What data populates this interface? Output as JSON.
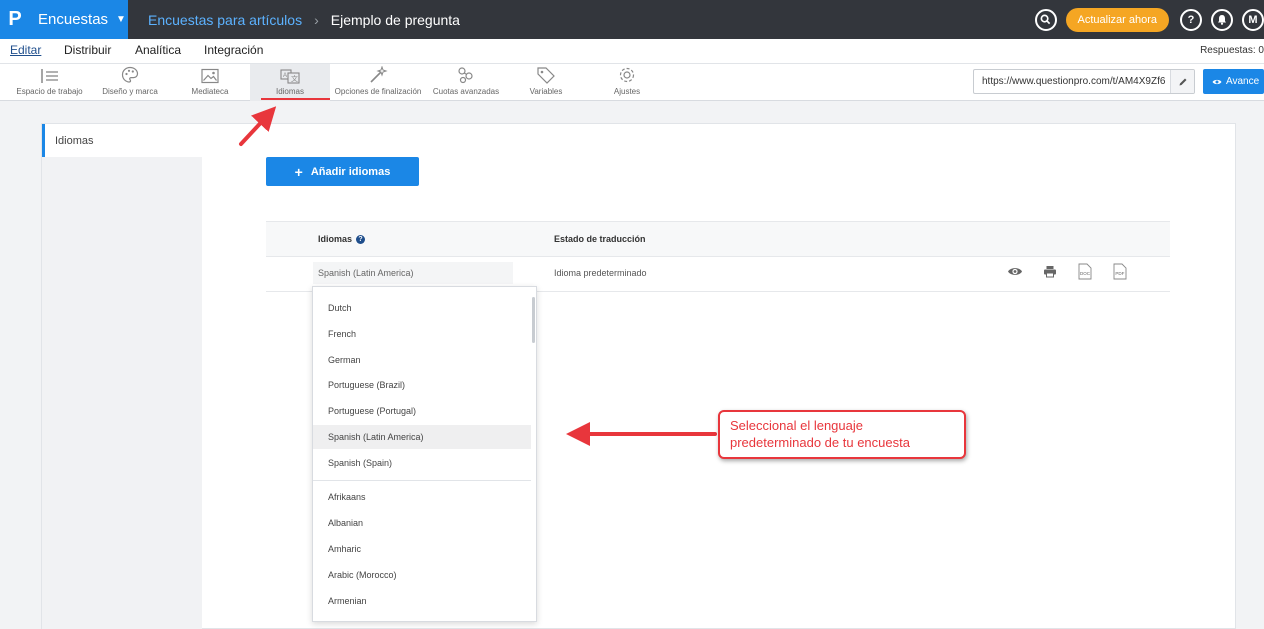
{
  "topbar": {
    "logo": "P",
    "product": "Encuestas",
    "breadcrumb_parent": "Encuestas para artículos",
    "breadcrumb_sep": "›",
    "breadcrumb_current": "Ejemplo de pregunta",
    "search_icon": "search-icon",
    "upgrade_label": "Actualizar ahora",
    "help_label": "?",
    "avatar_initial": "M"
  },
  "nav": {
    "items": [
      "Editar",
      "Distribuir",
      "Analítica",
      "Integración"
    ],
    "active": "Editar",
    "responses_label": "Respuestas: 0"
  },
  "toolbar": {
    "items": [
      {
        "label": "Espacio de trabajo",
        "icon": "workspace-icon"
      },
      {
        "label": "Diseño y marca",
        "icon": "palette-icon"
      },
      {
        "label": "Mediateca",
        "icon": "image-icon"
      },
      {
        "label": "Idiomas",
        "icon": "translate-icon",
        "active": true
      },
      {
        "label": "Opciones de finalización",
        "icon": "magic-wand-icon"
      },
      {
        "label": "Cuotas avanzadas",
        "icon": "quota-icon"
      },
      {
        "label": "Variables",
        "icon": "tag-icon"
      },
      {
        "label": "Ajustes",
        "icon": "gear-icon"
      }
    ],
    "url": "https://www.questionpro.com/t/AM4X9Zf6",
    "advance_label": "Avance"
  },
  "sidebar": {
    "active_item": "Idiomas"
  },
  "main": {
    "add_button_label": "Añadir idiomas",
    "table": {
      "col_languages": "Idiomas",
      "col_state": "Estado de traducción",
      "row": {
        "language": "Spanish (Latin America)",
        "state": "Idioma predeterminado"
      }
    }
  },
  "dropdown": {
    "group1": [
      "Dutch",
      "French",
      "German",
      "Portuguese (Brazil)",
      "Portuguese (Portugal)",
      "Spanish (Latin America)",
      "Spanish (Spain)"
    ],
    "highlighted": "Spanish (Latin America)",
    "group2": [
      "Afrikaans",
      "Albanian",
      "Amharic",
      "Arabic (Morocco)",
      "Armenian"
    ]
  },
  "annotation": {
    "line1": "Seleccional el lenguaje",
    "line2": "predeterminado de tu encuesta",
    "color": "#e8363c"
  },
  "colors": {
    "primary": "#1b87e6",
    "topbar": "#33363c",
    "accent_red": "#e8363c",
    "upgrade": "#f5a623"
  }
}
